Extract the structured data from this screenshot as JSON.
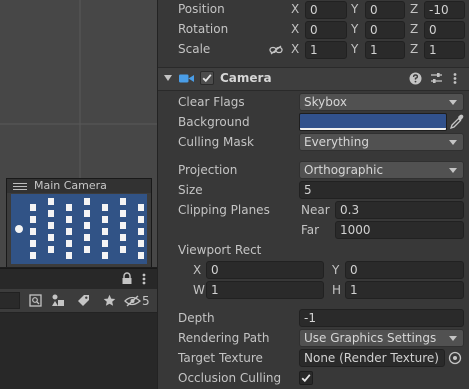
{
  "scene_preview": {
    "title": "Main Camera"
  },
  "hierarchy": {
    "hidden_count": "5"
  },
  "transform": {
    "position": {
      "label": "Position",
      "x": "0",
      "y": "0",
      "z": "-10"
    },
    "rotation": {
      "label": "Rotation",
      "x": "0",
      "y": "0",
      "z": "0"
    },
    "scale": {
      "label": "Scale",
      "x": "1",
      "y": "1",
      "z": "1"
    },
    "axis_x": "X",
    "axis_y": "Y",
    "axis_z": "Z"
  },
  "camera": {
    "title": "Camera",
    "enabled": true,
    "clear_flags": {
      "label": "Clear Flags",
      "value": "Skybox"
    },
    "background": {
      "label": "Background",
      "color": "#31518c"
    },
    "culling_mask": {
      "label": "Culling Mask",
      "value": "Everything"
    },
    "projection": {
      "label": "Projection",
      "value": "Orthographic"
    },
    "size": {
      "label": "Size",
      "value": "5"
    },
    "clipping_planes": {
      "label": "Clipping Planes",
      "near_label": "Near",
      "near": "0.3",
      "far_label": "Far",
      "far": "1000"
    },
    "viewport_rect": {
      "label": "Viewport Rect",
      "x_label": "X",
      "x": "0",
      "y_label": "Y",
      "y": "0",
      "w_label": "W",
      "w": "1",
      "h_label": "H",
      "h": "1"
    },
    "depth": {
      "label": "Depth",
      "value": "-1"
    },
    "rendering_path": {
      "label": "Rendering Path",
      "value": "Use Graphics Settings"
    },
    "target_texture": {
      "label": "Target Texture",
      "value": "None (Render Texture)"
    },
    "occlusion_culling": {
      "label": "Occlusion Culling",
      "checked": true
    }
  },
  "colors": {
    "accent_blue": "#4a9ee8",
    "scene_bg": "#474747",
    "inspector_bg": "#383838"
  }
}
